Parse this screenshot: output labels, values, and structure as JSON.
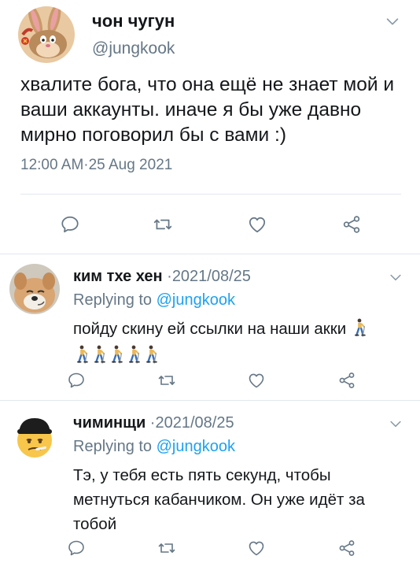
{
  "main_tweet": {
    "display_name": "чон чугун",
    "handle": "@jungkook",
    "text": "хвалите бога, что она ещё не знает мой и ваши аккаунты. иначе я бы уже давно мирно поговорил бы с вами :)",
    "time": "12:00 AM",
    "date": "25 Aug 2021",
    "meta_separator": "·"
  },
  "replies": [
    {
      "display_name": "ким тхе хен",
      "date": "2021/08/25",
      "date_prefix": " ·",
      "replying_label": "Replying to ",
      "replying_to": "@jungkook",
      "text": "пойду скину ей ссылки на наши акки",
      "emoji": "person-walking-with-cane",
      "emoji_count": 6
    },
    {
      "display_name": "чиминщи",
      "date": "2021/08/25",
      "date_prefix": " ·",
      "replying_label": "Replying to ",
      "replying_to": "@jungkook",
      "text": "Тэ, у тебя есть пять секунд, чтобы метнуться кабанчиком. Он уже идёт за тобой"
    }
  ],
  "icons": {
    "reply": "reply-icon",
    "retweet": "retweet-icon",
    "like": "heart-icon",
    "share": "share-icon",
    "menu": "chevron-down-icon"
  },
  "colors": {
    "text": "#14171a",
    "secondary": "#657786",
    "link": "#1da1f2",
    "divider": "#e1e8ed",
    "icon": "#657786"
  }
}
